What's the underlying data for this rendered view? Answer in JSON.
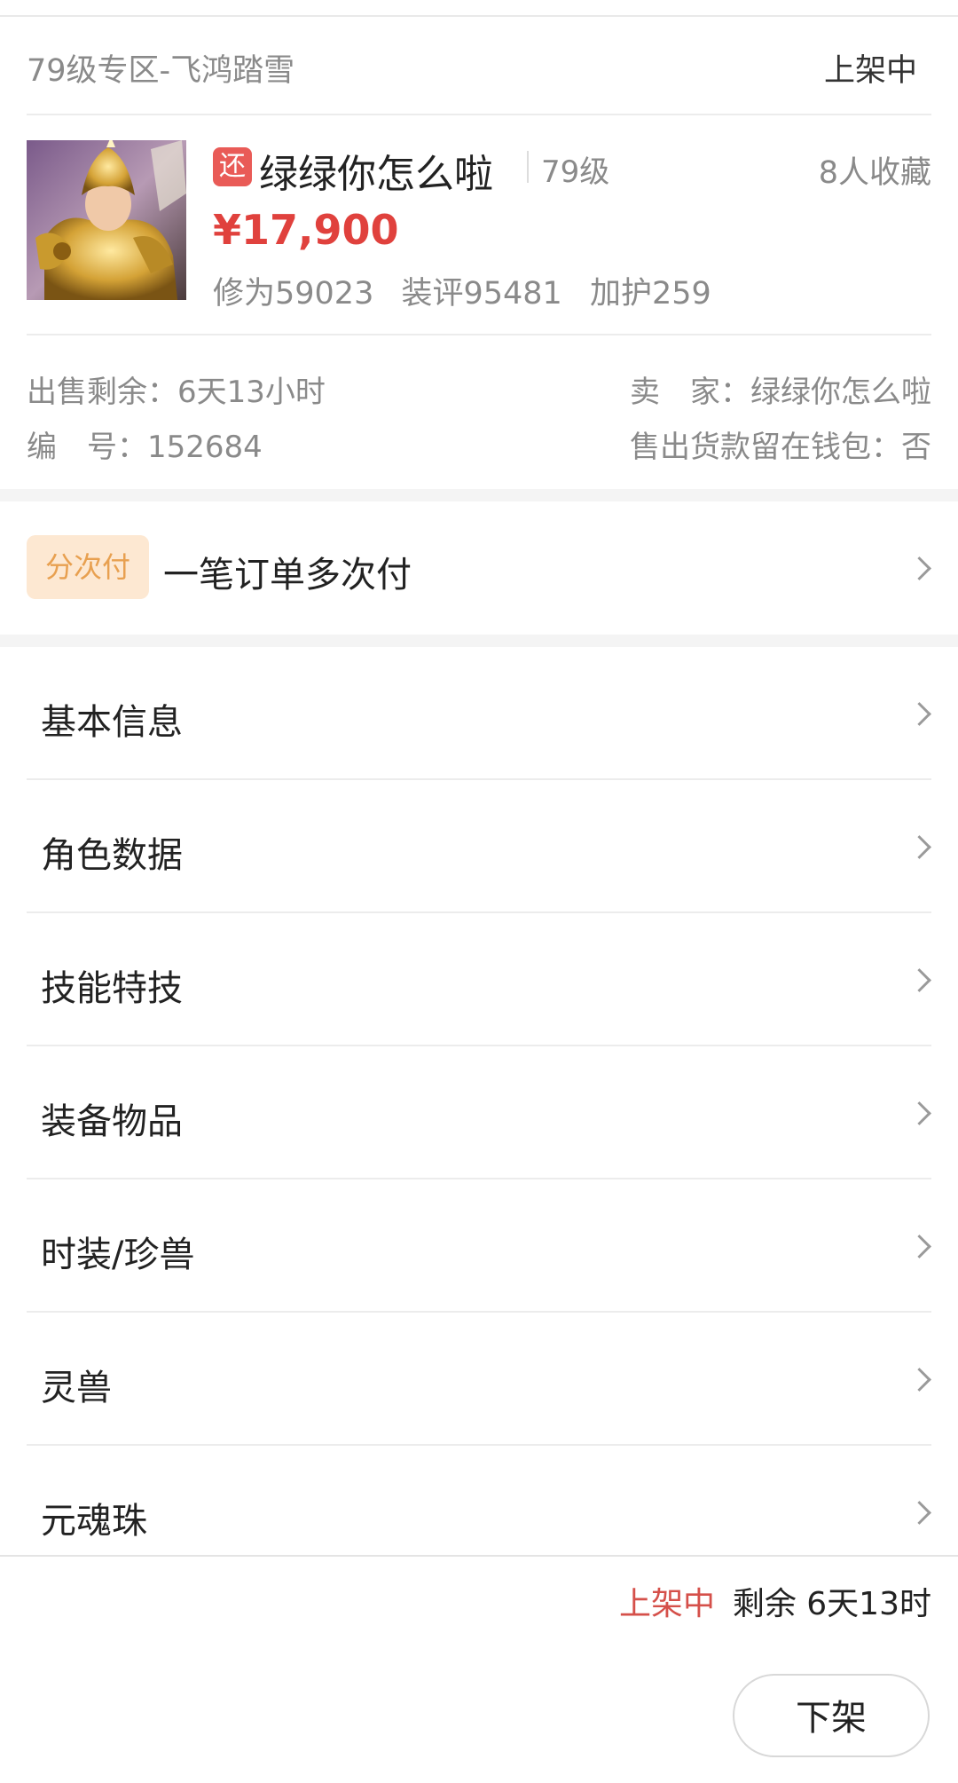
{
  "header": {
    "zone": "79级专区-飞鸿踏雪",
    "status": "上架中"
  },
  "product": {
    "image_icon": "character-portrait",
    "badge": "还",
    "name": "绿绿你怎么啦",
    "level": "79级",
    "favorites": "8人收藏",
    "price": "¥17,900",
    "stats": [
      "修为59023",
      "装评95481",
      "加护259"
    ]
  },
  "meta": {
    "remaining": "出售剩余：6天13小时",
    "serial": "编　号：152684",
    "seller": "卖　家：绿绿你怎么啦",
    "wallet": "售出货款留在钱包：否"
  },
  "installment": {
    "tag": "分次付",
    "text": "一笔订单多次付"
  },
  "menu": [
    {
      "label": "基本信息"
    },
    {
      "label": "角色数据"
    },
    {
      "label": "技能特技"
    },
    {
      "label": "装备物品"
    },
    {
      "label": "时装/珍兽"
    },
    {
      "label": "灵兽"
    },
    {
      "label": "元魂珠"
    }
  ],
  "footer": {
    "status": "上架中",
    "remaining": "剩余 6天13时",
    "delist_label": "下架"
  },
  "colors": {
    "price_red": "#e0413d",
    "badge_red": "#e95b57",
    "installment_bg": "#fde8d2",
    "installment_text": "#e8a050",
    "status_red": "#d5504a"
  }
}
